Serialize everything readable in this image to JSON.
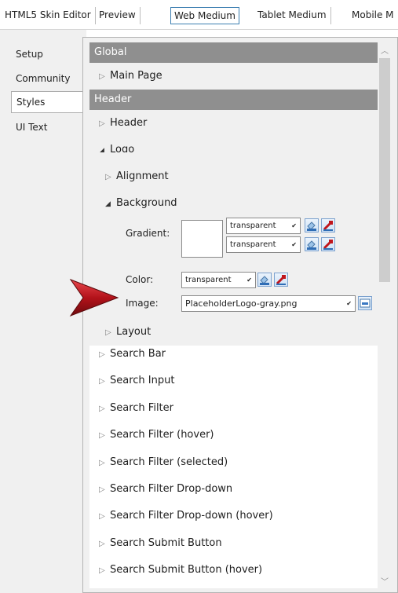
{
  "top_tabs": [
    "HTML5 Skin Editor",
    "Preview",
    "Web Medium",
    "Tablet Medium",
    "Mobile M"
  ],
  "left_nav": [
    "Setup",
    "Community",
    "Styles",
    "UI Text"
  ],
  "sections": {
    "global": "Global",
    "main_page": "Main Page",
    "header_section": "Header",
    "header_item": "Header",
    "logo": "Logo",
    "alignment": "Alignment",
    "background": "Background",
    "layout": "Layout"
  },
  "fields": {
    "gradient_label": "Gradient:",
    "gradient_value_1": "transparent",
    "gradient_value_2": "transparent",
    "color_label": "Color:",
    "color_value": "transparent",
    "image_label": "Image:",
    "image_value": "PlaceholderLogo-gray.png"
  },
  "items": [
    "Search Bar",
    "Search Input",
    "Search Filter",
    "Search Filter (hover)",
    "Search Filter (selected)",
    "Search Filter Drop-down",
    "Search Filter Drop-down (hover)",
    "Search Submit Button",
    "Search Submit Button (hover)"
  ],
  "icons": {
    "collapsed": "▷",
    "expanded": "◢",
    "dropdown": "ˇ",
    "color_picker": "paint-bucket-icon",
    "eyedropper": "eyedropper-icon",
    "browse": "image-browse-icon",
    "pointer": "red-arrow-pointer"
  },
  "colors": {
    "section_header_bg": "#8f8f8f",
    "active_tab_border": "#3c7fb1",
    "pointer_red": "#c0161c"
  }
}
